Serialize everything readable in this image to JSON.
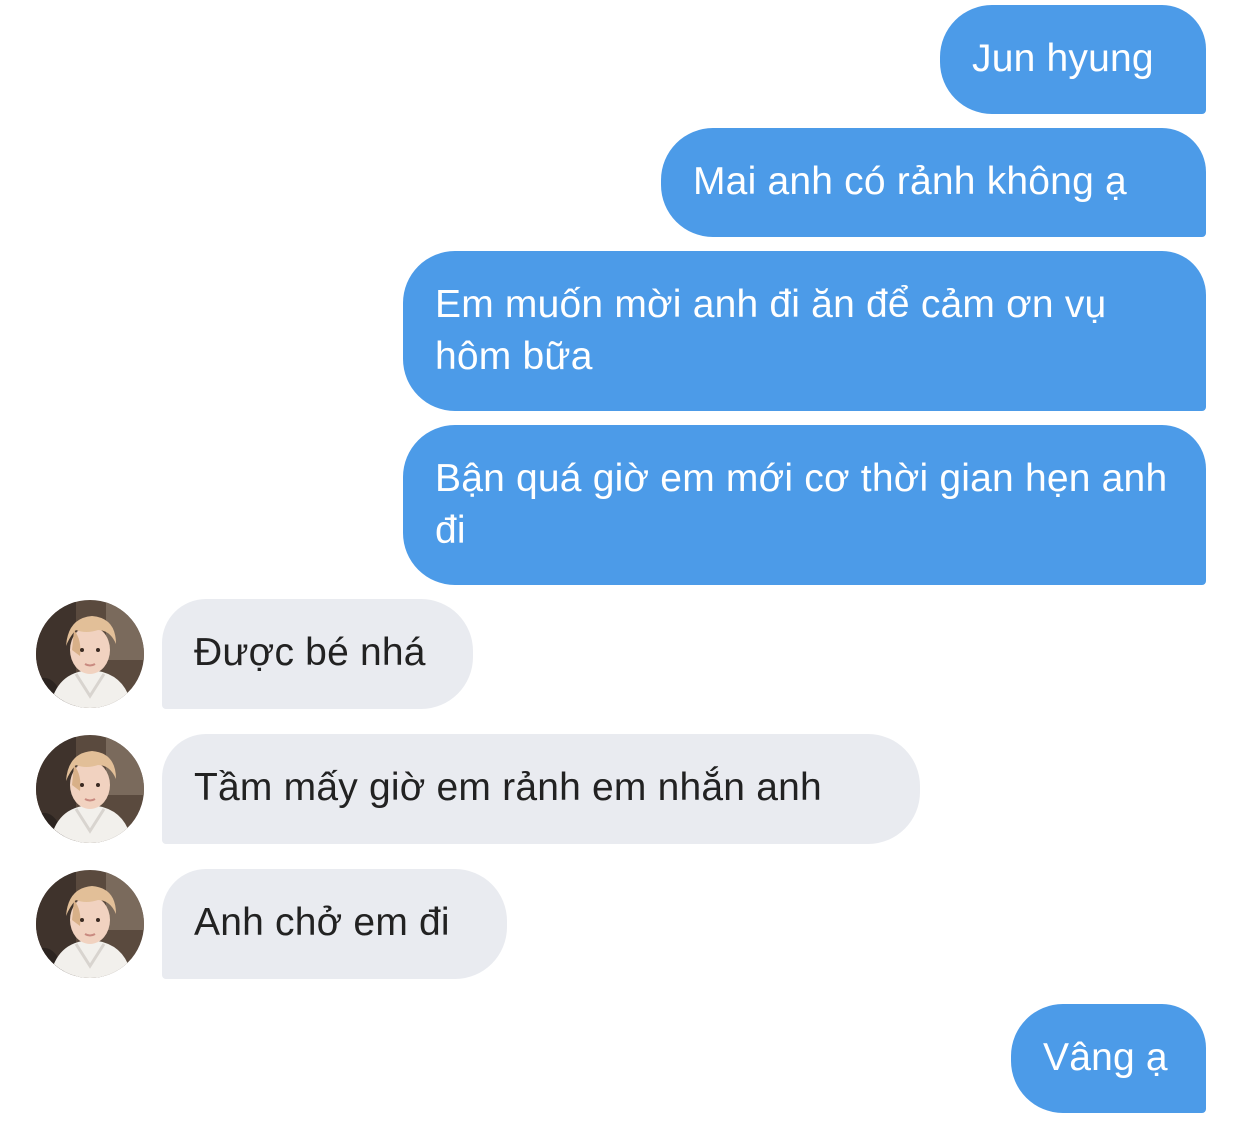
{
  "conversation": {
    "messages": [
      {
        "sender": "me",
        "text": "Jun hyung"
      },
      {
        "sender": "me",
        "text": "Mai anh có rảnh không ạ"
      },
      {
        "sender": "me",
        "text": "Em muốn mời anh đi ăn để cảm ơn vụ hôm bữa"
      },
      {
        "sender": "me",
        "text": "Bận quá giờ em mới cơ thời gian hẹn anh đi"
      },
      {
        "sender": "them",
        "text": "Được bé nhá"
      },
      {
        "sender": "them",
        "text": "Tầm mấy giờ em rảnh em nhắn anh"
      },
      {
        "sender": "them",
        "text": "Anh chở em đi"
      },
      {
        "sender": "me",
        "text": "Vâng ạ"
      }
    ]
  },
  "colors": {
    "sent_bubble": "#4c9be8",
    "received_bubble": "#e9ebf0"
  },
  "icons": {
    "avatar": "contact-avatar-photo"
  }
}
